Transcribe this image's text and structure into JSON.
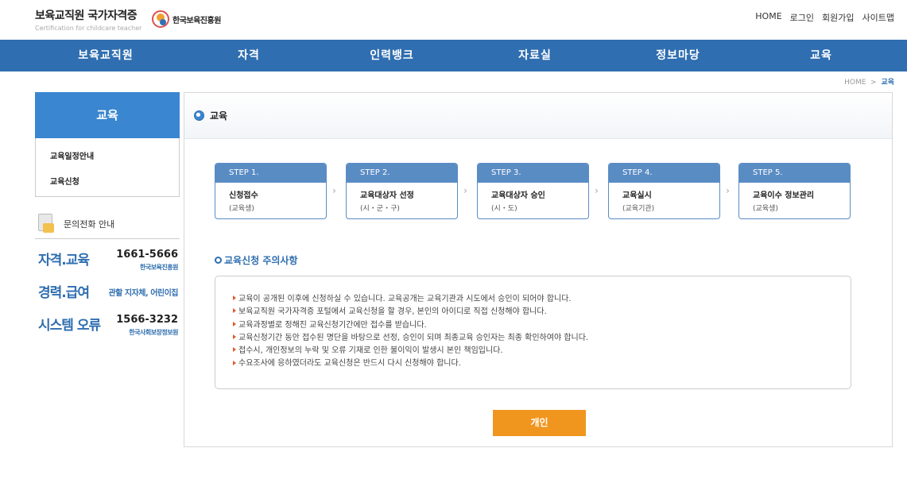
{
  "header": {
    "title": "보육교직원 국가자격증",
    "subtitle": "Certification for childcare teacher",
    "org_logo_text": "한국보육진흥원",
    "org_logo_icon": "KCPI",
    "top_links": [
      "HOME",
      "로그인",
      "회원가입",
      "사이트맵"
    ]
  },
  "gnb": [
    "보육교직원",
    "자격",
    "인력뱅크",
    "자료실",
    "정보마당",
    "교육"
  ],
  "breadcrumb": {
    "home": "HOME",
    "sep": ">",
    "current": "교육"
  },
  "sidebar": {
    "title": "교육",
    "items": [
      "교육일정안내",
      "교육신청"
    ],
    "contact_label": "문의전화 안내",
    "contacts": [
      {
        "title": "자격.교육",
        "phone": "1661-5666",
        "org": "한국보육진흥원"
      },
      {
        "title": "경력.급여",
        "phone": "",
        "org": "관할 지자체, 어린이집"
      },
      {
        "title": "시스템 오류",
        "phone": "1566-3232",
        "org": "한국사회보장정보원"
      }
    ]
  },
  "main": {
    "title": "교육",
    "steps": [
      {
        "step": "STEP 1.",
        "name": "신청접수",
        "sub": "(교육생)"
      },
      {
        "step": "STEP 2.",
        "name": "교육대상자 선정",
        "sub": "(시・군・구)"
      },
      {
        "step": "STEP 3.",
        "name": "교육대상자 승인",
        "sub": "(시・도)"
      },
      {
        "step": "STEP 4.",
        "name": "교육실시",
        "sub": "(교육기관)"
      },
      {
        "step": "STEP 5.",
        "name": "교육이수 정보관리",
        "sub": "(교육생)"
      }
    ],
    "notes_title": "교육신청 주의사항",
    "notes": [
      "교육이 공개된 이후에 신청하실 수 있습니다. 교육공개는 교육기관과 시도에서 승인이 되어야 합니다.",
      "보육교직원 국가자격증 포털에서 교육신청을 할 경우, 본인의 아이디로 직접 신청해야 합니다.",
      "교육과정별로 정해진 교육신청기간에만 접수를 받습니다.",
      "교육신청기간 동안 접수된 명단을 바탕으로 선정, 승인이 되며 최종교육 승인자는 최종 확인하여야 합니다.",
      "접수시, 개인정보의 누락 및 오류 기재로 인한 불이익이 발생시 본인 책임입니다.",
      "수요조사에 응하였더라도 교육신청은 반드시 다시 신청해야 합니다."
    ],
    "button_label": "개인"
  },
  "colors": {
    "brand": "#2f6eb0",
    "sidebar_title": "#3a86d0",
    "step": "#5a8cc4",
    "button": "#f0961e",
    "note_bullet": "#e05a2a"
  }
}
